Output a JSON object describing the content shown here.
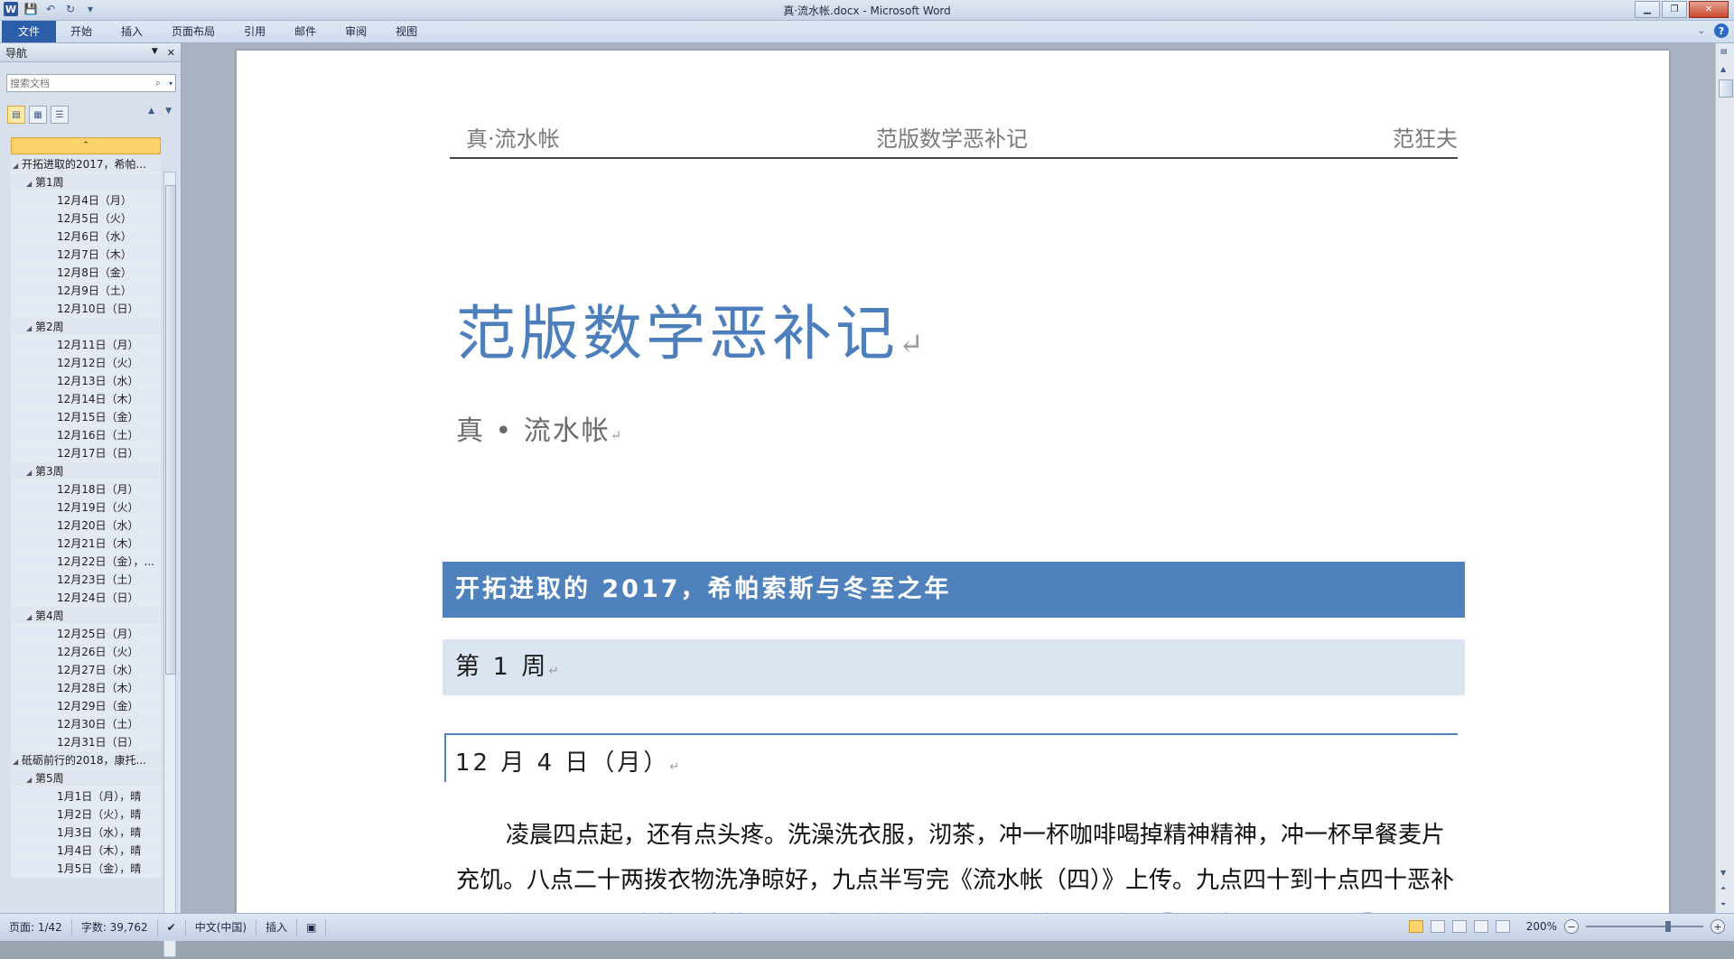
{
  "window": {
    "title": "真·流水帐.docx - Microsoft Word"
  },
  "quick_access": {
    "app_icon": "W",
    "save": "💾",
    "undo": "↶",
    "redo": "↻",
    "customize": "▾"
  },
  "ribbon": {
    "tabs": [
      "文件",
      "开始",
      "插入",
      "页面布局",
      "引用",
      "邮件",
      "审阅",
      "视图"
    ]
  },
  "nav": {
    "title": "导航",
    "search_placeholder": "搜索文档",
    "tree": [
      {
        "level": 1,
        "label": "开拓进取的2017，希帕..."
      },
      {
        "level": 2,
        "label": "第1周"
      },
      {
        "level": 3,
        "label": "12月4日（月）"
      },
      {
        "level": 3,
        "label": "12月5日（火）"
      },
      {
        "level": 3,
        "label": "12月6日（水）"
      },
      {
        "level": 3,
        "label": "12月7日（木）"
      },
      {
        "level": 3,
        "label": "12月8日（金）"
      },
      {
        "level": 3,
        "label": "12月9日（土）"
      },
      {
        "level": 3,
        "label": "12月10日（日）"
      },
      {
        "level": 2,
        "label": "第2周"
      },
      {
        "level": 3,
        "label": "12月11日（月）"
      },
      {
        "level": 3,
        "label": "12月12日（火）"
      },
      {
        "level": 3,
        "label": "12月13日（水）"
      },
      {
        "level": 3,
        "label": "12月14日（木）"
      },
      {
        "level": 3,
        "label": "12月15日（金）"
      },
      {
        "level": 3,
        "label": "12月16日（土）"
      },
      {
        "level": 3,
        "label": "12月17日（日）"
      },
      {
        "level": 2,
        "label": "第3周"
      },
      {
        "level": 3,
        "label": "12月18日（月）"
      },
      {
        "level": 3,
        "label": "12月19日（火）"
      },
      {
        "level": 3,
        "label": "12月20日（水）"
      },
      {
        "level": 3,
        "label": "12月21日（木）"
      },
      {
        "level": 3,
        "label": "12月22日（金），..."
      },
      {
        "level": 3,
        "label": "12月23日（土）"
      },
      {
        "level": 3,
        "label": "12月24日（日）"
      },
      {
        "level": 2,
        "label": "第4周"
      },
      {
        "level": 3,
        "label": "12月25日（月）"
      },
      {
        "level": 3,
        "label": "12月26日（火）"
      },
      {
        "level": 3,
        "label": "12月27日（水）"
      },
      {
        "level": 3,
        "label": "12月28日（木）"
      },
      {
        "level": 3,
        "label": "12月29日（金）"
      },
      {
        "level": 3,
        "label": "12月30日（土）"
      },
      {
        "level": 3,
        "label": "12月31日（日）"
      },
      {
        "level": 1,
        "label": "砥砺前行的2018，康托..."
      },
      {
        "level": 2,
        "label": "第5周"
      },
      {
        "level": 3,
        "label": "1月1日（月），晴"
      },
      {
        "level": 3,
        "label": "1月2日（火），晴"
      },
      {
        "level": 3,
        "label": "1月3日（水），晴"
      },
      {
        "level": 3,
        "label": "1月4日（木），晴"
      },
      {
        "level": 3,
        "label": "1月5日（金），晴"
      }
    ]
  },
  "document": {
    "header_left": "真·流水帐",
    "header_center": "范版数学恶补记",
    "header_right": "范狂夫",
    "title": "范版数学恶补记",
    "subtitle": "真 • 流水帐",
    "heading1": "开拓进取的 2017，希帕索斯与冬至之年",
    "heading2": "第 1 周",
    "heading3": "12 月 4 日（月）",
    "body": "凌晨四点起，还有点头疼。洗澡洗衣服，沏茶，冲一杯咖啡喝掉精神精神，冲一杯早餐麦片充饥。八点二十两拨衣物洗净晾好，九点半写完《流水帐（四）》上传。九点四十到十点四十恶补《解析几何》，看完第一章第一节。十一点多出门吃饭，楼门口对面「阿杰餐厅」，还是「笼"
  },
  "status": {
    "page": "页面: 1/42",
    "words": "字数: 39,762",
    "language": "中文(中国)",
    "mode": "插入",
    "zoom": "200%"
  },
  "colors": {
    "heading_fill": "#4f81bd",
    "heading2_fill": "#dbe5f1",
    "title_color": "#4d7fbd"
  }
}
